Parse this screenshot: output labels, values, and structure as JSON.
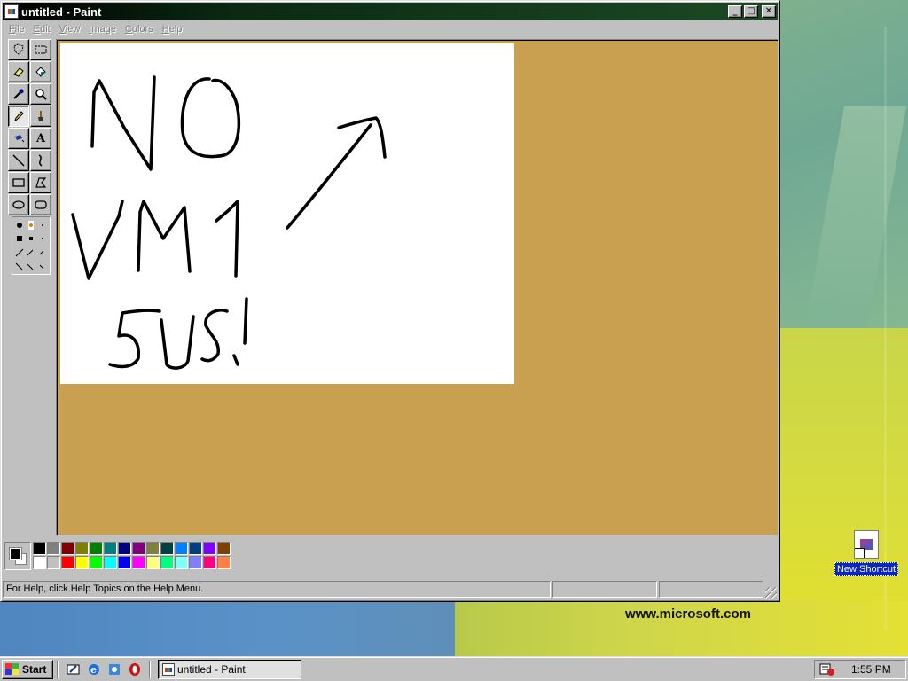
{
  "window": {
    "title": "untitled - Paint",
    "minimize_glyph": "_",
    "maximize_glyph": "□",
    "close_glyph": "✕"
  },
  "menu": [
    {
      "accel": "F",
      "rest": "ile"
    },
    {
      "accel": "E",
      "rest": "dit"
    },
    {
      "accel": "V",
      "rest": "iew"
    },
    {
      "accel": "I",
      "rest": "mage"
    },
    {
      "accel": "C",
      "rest": "olors"
    },
    {
      "accel": "H",
      "rest": "elp"
    }
  ],
  "tools": [
    {
      "name": "free-form-select-icon"
    },
    {
      "name": "select-icon"
    },
    {
      "name": "eraser-icon"
    },
    {
      "name": "fill-bucket-icon"
    },
    {
      "name": "pick-color-icon"
    },
    {
      "name": "magnifier-icon"
    },
    {
      "name": "pencil-icon",
      "active": true
    },
    {
      "name": "brush-icon"
    },
    {
      "name": "airbrush-icon"
    },
    {
      "name": "text-icon",
      "glyph": "A"
    },
    {
      "name": "line-icon"
    },
    {
      "name": "curve-icon"
    },
    {
      "name": "rectangle-icon"
    },
    {
      "name": "polygon-icon"
    },
    {
      "name": "ellipse-icon"
    },
    {
      "name": "rounded-rectangle-icon"
    }
  ],
  "palette": {
    "foreground": "#000000",
    "background": "#ffffff",
    "top_row": [
      "#000000",
      "#808080",
      "#800000",
      "#808000",
      "#008000",
      "#008080",
      "#000080",
      "#800080",
      "#808040",
      "#004040",
      "#0080ff",
      "#004080",
      "#8000ff",
      "#804000"
    ],
    "bottom_row": [
      "#ffffff",
      "#c0c0c0",
      "#ff0000",
      "#ffff00",
      "#00ff00",
      "#00ffff",
      "#0000ff",
      "#ff00ff",
      "#ffff80",
      "#00ff80",
      "#80ffff",
      "#8080ff",
      "#ff0080",
      "#ff8040"
    ]
  },
  "status": {
    "help_text": "For Help, click Help Topics on the Help Menu.",
    "coords": "",
    "size": ""
  },
  "desktop": {
    "icon_label": "New Shortcut",
    "watermark": "www.microsoft.com"
  },
  "taskbar": {
    "start_label": "Start",
    "quick_launch": [
      "show-desktop-icon",
      "internet-explorer-icon",
      "channels-icon",
      "opera-icon"
    ],
    "task_label": "untitled - Paint",
    "clock": "1:55 PM"
  },
  "colors": {
    "title_bar_start": "#000000",
    "title_bar_end": "#1c4a25",
    "workspace": "#c8a050",
    "face": "#c0c0c0"
  }
}
